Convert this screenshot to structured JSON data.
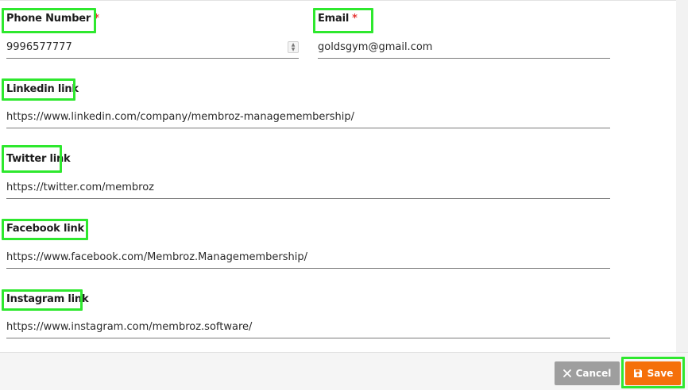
{
  "form": {
    "phone": {
      "label": "Phone Number",
      "required_mark": "*",
      "value": "9996577777"
    },
    "email": {
      "label": "Email",
      "required_mark": "*",
      "value": "goldsgym@gmail.com"
    },
    "linkedin": {
      "label": "Linkedin link",
      "value": "https://www.linkedin.com/company/membroz-managemembership/"
    },
    "twitter": {
      "label": "Twitter link",
      "value": "https://twitter.com/membroz"
    },
    "facebook": {
      "label": "Facebook link",
      "value": "https://www.facebook.com/Membroz.Managemembership/"
    },
    "instagram": {
      "label": "Instagram link",
      "value": "https://www.instagram.com/membroz.software/"
    }
  },
  "footer": {
    "cancel_label": "Cancel",
    "save_label": "Save",
    "cancel_icon": "close-icon",
    "save_icon": "floppy-disk-icon"
  },
  "colors": {
    "highlight": "#2ee82e",
    "save_button": "#f5700a",
    "cancel_button": "#9e9e9e",
    "required": "#e53935"
  }
}
